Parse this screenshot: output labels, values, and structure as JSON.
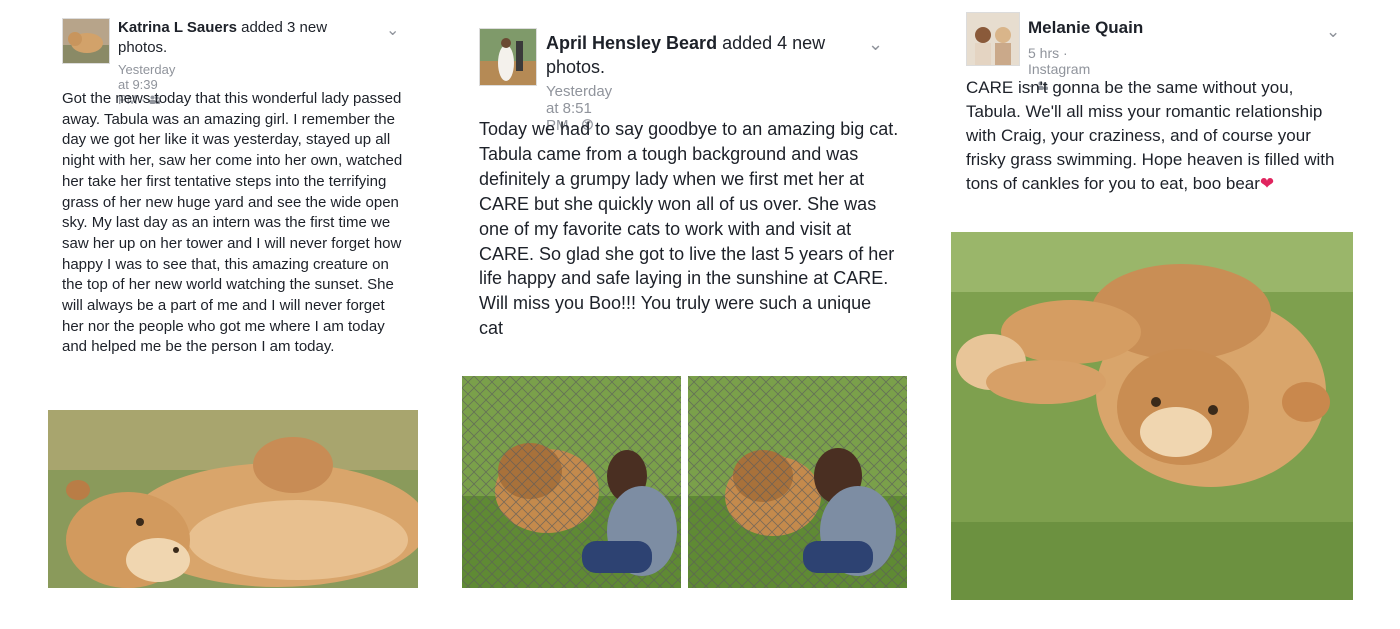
{
  "posts": [
    {
      "author": "Katrina L Sauers",
      "action": "added 3 new photos.",
      "time": "Yesterday at 9:39 PM",
      "separator": "·",
      "audience_icon": "friends-icon",
      "text": "Got the news today that this wonderful lady passed away. Tabula was an amazing girl. I remember the day we got her like it was yesterday, stayed up all night with her, saw her come into her own, watched her take her first tentative steps into the terrifying grass of her new huge yard and see the wide open sky. My last day as an intern was the first time we saw her up on her tower and I will never forget how happy I was to see that, this amazing creature on the top of her new world watching the sunset. She will always be a part of me and I will never forget her nor the people who got me where I am today and helped me be the person I am today."
    },
    {
      "author": "April Hensley Beard",
      "action": "added 4 new photos.",
      "time": "Yesterday at 8:51 PM",
      "separator": "·",
      "audience_icon": "globe-icon",
      "text": "Today we had to say goodbye to an amazing big cat. Tabula came from a tough background and was definitely a grumpy lady when we first met her at CARE but she quickly won all of us over. She was one of my favorite cats to work with and visit at CARE. So glad she got to live the last 5 years of her life happy and safe laying in the sunshine at CARE. Will miss you Boo!!! You truly were such a unique cat"
    },
    {
      "author": "Melanie Quain",
      "time": "5 hrs",
      "separator": "·",
      "source": "Instagram",
      "audience_icon": "friends-icon",
      "text": "CARE isn't gonna be the same without you, Tabula. We'll all miss your romantic relationship with Craig, your craziness, and of course your frisky grass swimming. Hope heaven is filled with tons of cankles for you to eat, boo bear",
      "emoji": "❤"
    }
  ],
  "icons": {
    "chevron": "chevron-down-icon",
    "heart": "heart-emoji-icon"
  },
  "colors": {
    "text": "#1d2129",
    "meta": "#90949c",
    "heart": "#e0245e",
    "grass": "#6f8f3c",
    "lion": "#d9a56b"
  }
}
